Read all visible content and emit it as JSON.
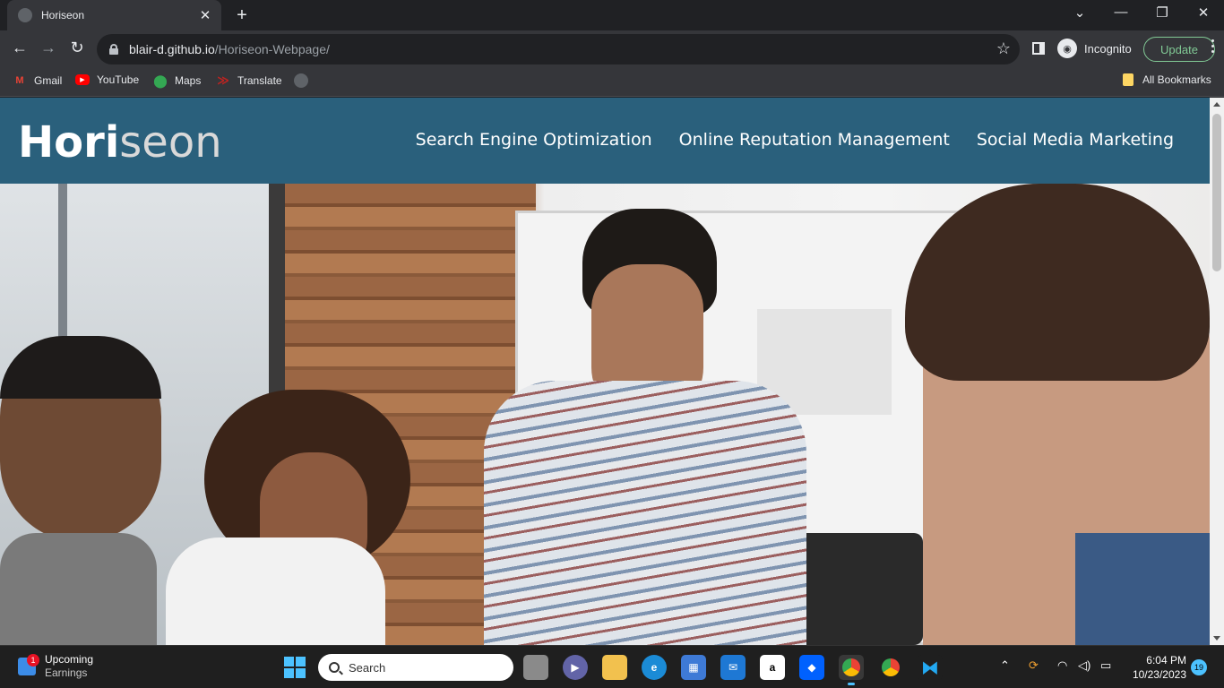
{
  "browser": {
    "tab_title": "Horiseon",
    "url_host": "blair-d.github.io",
    "url_path": "/Horiseon-Webpage/",
    "incognito_label": "Incognito",
    "update_label": "Update",
    "bookmarks": [
      "Gmail",
      "YouTube",
      "Maps",
      "Translate"
    ],
    "all_bookmarks_label": "All Bookmarks"
  },
  "site": {
    "logo_main": "Hori",
    "logo_accent": "seon",
    "nav": [
      "Search Engine Optimization",
      "Online Reputation Management",
      "Social Media Marketing"
    ],
    "header_color": "#2a607c"
  },
  "taskbar": {
    "widget_title": "Upcoming",
    "widget_subtitle": "Earnings",
    "widget_badge": "1",
    "search_placeholder": "Search",
    "time": "6:04 PM",
    "date": "10/23/2023",
    "notification_count": "19"
  }
}
